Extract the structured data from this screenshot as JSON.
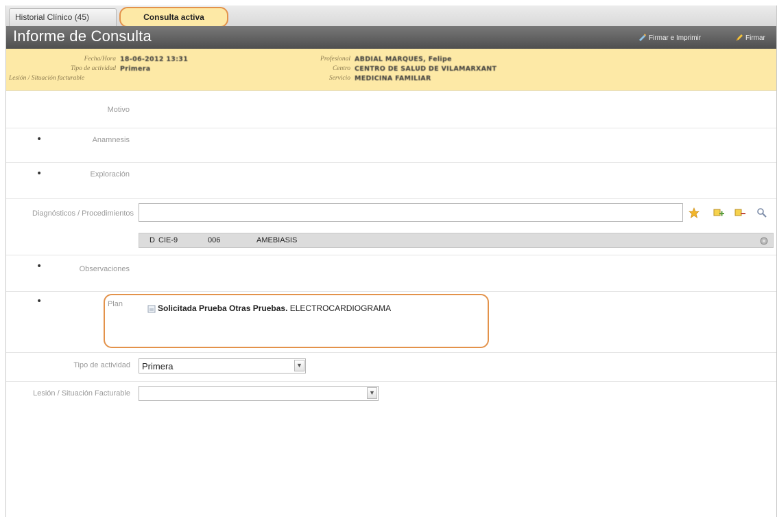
{
  "tabs": {
    "history": "Historial Clínico (45)",
    "active": "Consulta activa"
  },
  "header": {
    "title": "Informe de Consulta",
    "sign_print": "Firmar e Imprimir",
    "sign": "Firmar"
  },
  "info": {
    "fecha_label": "Fecha/Hora",
    "fecha_value": "18-06-2012 13:31",
    "tipo_label": "Tipo de actividad",
    "tipo_value": "Primera",
    "lesion_label": "Lesión / Situación facturable",
    "profesional_label": "Profesional",
    "profesional_value": "ABDIAL MARQUES, Felipe",
    "centro_label": "Centro",
    "centro_value": "CENTRO DE SALUD DE VILAMARXANT",
    "servicio_label": "Servicio",
    "servicio_value": "MEDICINA FAMILIAR"
  },
  "form": {
    "motivo_label": "Motivo",
    "anamnesis_label": "Anamnesis",
    "exploracion_label": "Exploración",
    "diagnosticos_label": "Diagnósticos / Procedimientos",
    "diagnosticos_input": "",
    "diagnosis_row": {
      "type": "D",
      "code_system": "CIE-9",
      "code": "006",
      "description": "AMEBIASIS"
    },
    "observaciones_label": "Observaciones",
    "plan_label": "Plan",
    "plan_bold": "Solicitada Prueba Otras Pruebas.",
    "plan_text": "ELECTROCARDIOGRAMA",
    "tipo_actividad_label": "Tipo de actividad",
    "tipo_actividad_value": "Primera",
    "lesion_label": "Lesión / Situación Facturable",
    "lesion_value": ""
  },
  "bullets": {
    "glyph": "•"
  },
  "icons": {
    "favorite": "star-icon",
    "add_code": "add-code-icon",
    "remove_code": "remove-code-icon",
    "search": "search-icon",
    "settings": "gear-icon"
  },
  "colors": {
    "accent": "#e3924a",
    "band": "#fde9a6",
    "titlebar": "#5e5e5e"
  }
}
